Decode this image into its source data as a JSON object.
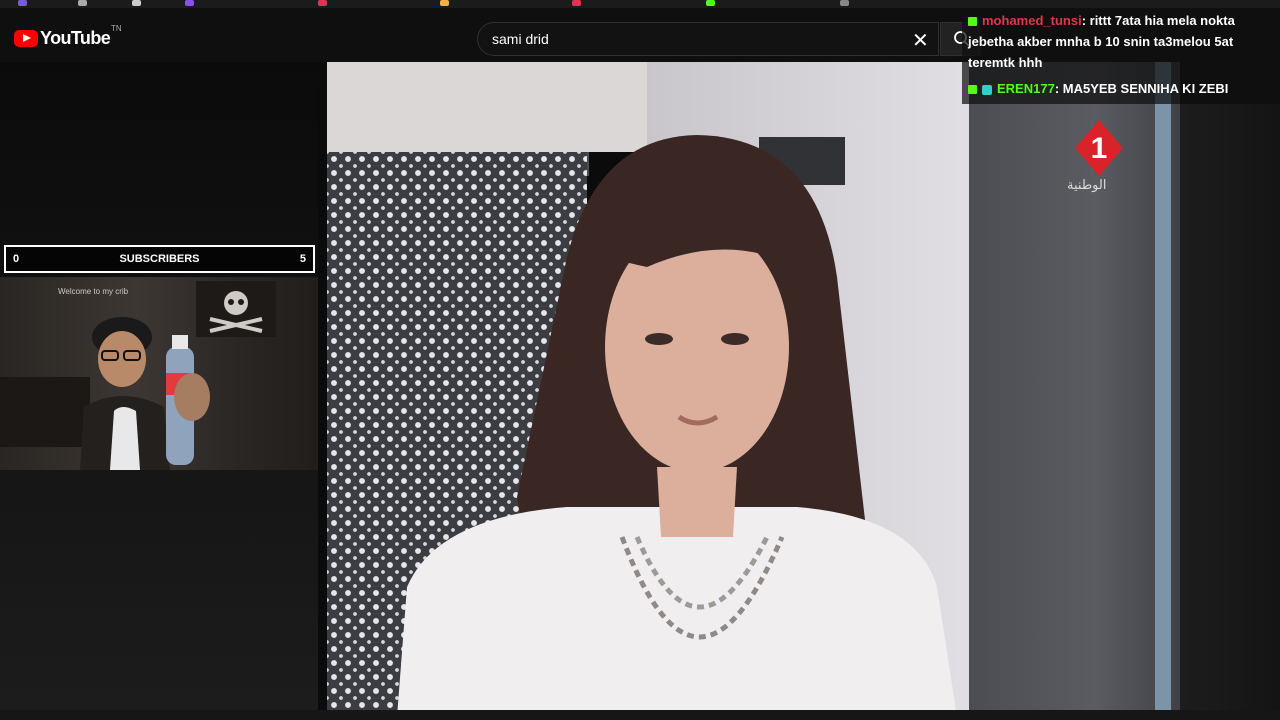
{
  "youtube": {
    "logo_text": "YouTube",
    "logo_region": "TN",
    "search_value": "sami drid"
  },
  "subscribers_bar": {
    "left_value": "0",
    "label": "SUBSCRIBERS",
    "right_value": "5"
  },
  "webcam": {
    "sign_text": "Welcome to my crib"
  },
  "video": {
    "channel_logo_number": "1",
    "channel_name_arabic": "الوطنية"
  },
  "chat": {
    "messages": [
      {
        "user": "mohamed_tunsi",
        "text": ": rittt 7ata hia mela nokta jebetha akber mnha b 10 snin ta3melou 5at teremtk hhh"
      },
      {
        "user": "EREN177",
        "text": ": MA5YEB SENNIHA KI ZEBI"
      }
    ]
  },
  "colors": {
    "youtube_red": "#ff0000",
    "chat_user1": "#e2344a",
    "chat_user2": "#53fc18",
    "kick_badge": "#53fc18"
  }
}
